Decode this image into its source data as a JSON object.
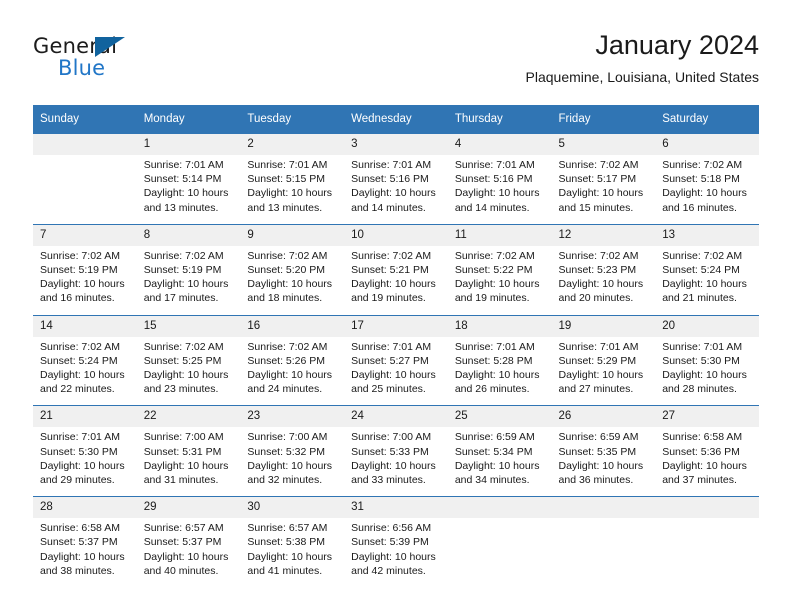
{
  "logo": {
    "text_primary": "General",
    "text_secondary": "Blue",
    "triangle_icon": "triangle-icon",
    "primary_color": "#1c1c1c",
    "secondary_color": "#2176c7",
    "triangle_color": "#11639e"
  },
  "header": {
    "title": "January 2024",
    "subtitle": "Plaquemine, Louisiana, United States"
  },
  "theme": {
    "header_bg": "#3075b4",
    "header_text": "#ffffff",
    "daynum_bg": "#f0f0f0",
    "body_text": "#1a1a1a",
    "grid_line": "#3075b4"
  },
  "weekday_headers": [
    "Sunday",
    "Monday",
    "Tuesday",
    "Wednesday",
    "Thursday",
    "Friday",
    "Saturday"
  ],
  "weeks": [
    [
      {
        "day": "",
        "lines": []
      },
      {
        "day": "1",
        "lines": [
          "Sunrise: 7:01 AM",
          "Sunset: 5:14 PM",
          "Daylight: 10 hours",
          "and 13 minutes."
        ]
      },
      {
        "day": "2",
        "lines": [
          "Sunrise: 7:01 AM",
          "Sunset: 5:15 PM",
          "Daylight: 10 hours",
          "and 13 minutes."
        ]
      },
      {
        "day": "3",
        "lines": [
          "Sunrise: 7:01 AM",
          "Sunset: 5:16 PM",
          "Daylight: 10 hours",
          "and 14 minutes."
        ]
      },
      {
        "day": "4",
        "lines": [
          "Sunrise: 7:01 AM",
          "Sunset: 5:16 PM",
          "Daylight: 10 hours",
          "and 14 minutes."
        ]
      },
      {
        "day": "5",
        "lines": [
          "Sunrise: 7:02 AM",
          "Sunset: 5:17 PM",
          "Daylight: 10 hours",
          "and 15 minutes."
        ]
      },
      {
        "day": "6",
        "lines": [
          "Sunrise: 7:02 AM",
          "Sunset: 5:18 PM",
          "Daylight: 10 hours",
          "and 16 minutes."
        ]
      }
    ],
    [
      {
        "day": "7",
        "lines": [
          "Sunrise: 7:02 AM",
          "Sunset: 5:19 PM",
          "Daylight: 10 hours",
          "and 16 minutes."
        ]
      },
      {
        "day": "8",
        "lines": [
          "Sunrise: 7:02 AM",
          "Sunset: 5:19 PM",
          "Daylight: 10 hours",
          "and 17 minutes."
        ]
      },
      {
        "day": "9",
        "lines": [
          "Sunrise: 7:02 AM",
          "Sunset: 5:20 PM",
          "Daylight: 10 hours",
          "and 18 minutes."
        ]
      },
      {
        "day": "10",
        "lines": [
          "Sunrise: 7:02 AM",
          "Sunset: 5:21 PM",
          "Daylight: 10 hours",
          "and 19 minutes."
        ]
      },
      {
        "day": "11",
        "lines": [
          "Sunrise: 7:02 AM",
          "Sunset: 5:22 PM",
          "Daylight: 10 hours",
          "and 19 minutes."
        ]
      },
      {
        "day": "12",
        "lines": [
          "Sunrise: 7:02 AM",
          "Sunset: 5:23 PM",
          "Daylight: 10 hours",
          "and 20 minutes."
        ]
      },
      {
        "day": "13",
        "lines": [
          "Sunrise: 7:02 AM",
          "Sunset: 5:24 PM",
          "Daylight: 10 hours",
          "and 21 minutes."
        ]
      }
    ],
    [
      {
        "day": "14",
        "lines": [
          "Sunrise: 7:02 AM",
          "Sunset: 5:24 PM",
          "Daylight: 10 hours",
          "and 22 minutes."
        ]
      },
      {
        "day": "15",
        "lines": [
          "Sunrise: 7:02 AM",
          "Sunset: 5:25 PM",
          "Daylight: 10 hours",
          "and 23 minutes."
        ]
      },
      {
        "day": "16",
        "lines": [
          "Sunrise: 7:02 AM",
          "Sunset: 5:26 PM",
          "Daylight: 10 hours",
          "and 24 minutes."
        ]
      },
      {
        "day": "17",
        "lines": [
          "Sunrise: 7:01 AM",
          "Sunset: 5:27 PM",
          "Daylight: 10 hours",
          "and 25 minutes."
        ]
      },
      {
        "day": "18",
        "lines": [
          "Sunrise: 7:01 AM",
          "Sunset: 5:28 PM",
          "Daylight: 10 hours",
          "and 26 minutes."
        ]
      },
      {
        "day": "19",
        "lines": [
          "Sunrise: 7:01 AM",
          "Sunset: 5:29 PM",
          "Daylight: 10 hours",
          "and 27 minutes."
        ]
      },
      {
        "day": "20",
        "lines": [
          "Sunrise: 7:01 AM",
          "Sunset: 5:30 PM",
          "Daylight: 10 hours",
          "and 28 minutes."
        ]
      }
    ],
    [
      {
        "day": "21",
        "lines": [
          "Sunrise: 7:01 AM",
          "Sunset: 5:30 PM",
          "Daylight: 10 hours",
          "and 29 minutes."
        ]
      },
      {
        "day": "22",
        "lines": [
          "Sunrise: 7:00 AM",
          "Sunset: 5:31 PM",
          "Daylight: 10 hours",
          "and 31 minutes."
        ]
      },
      {
        "day": "23",
        "lines": [
          "Sunrise: 7:00 AM",
          "Sunset: 5:32 PM",
          "Daylight: 10 hours",
          "and 32 minutes."
        ]
      },
      {
        "day": "24",
        "lines": [
          "Sunrise: 7:00 AM",
          "Sunset: 5:33 PM",
          "Daylight: 10 hours",
          "and 33 minutes."
        ]
      },
      {
        "day": "25",
        "lines": [
          "Sunrise: 6:59 AM",
          "Sunset: 5:34 PM",
          "Daylight: 10 hours",
          "and 34 minutes."
        ]
      },
      {
        "day": "26",
        "lines": [
          "Sunrise: 6:59 AM",
          "Sunset: 5:35 PM",
          "Daylight: 10 hours",
          "and 36 minutes."
        ]
      },
      {
        "day": "27",
        "lines": [
          "Sunrise: 6:58 AM",
          "Sunset: 5:36 PM",
          "Daylight: 10 hours",
          "and 37 minutes."
        ]
      }
    ],
    [
      {
        "day": "28",
        "lines": [
          "Sunrise: 6:58 AM",
          "Sunset: 5:37 PM",
          "Daylight: 10 hours",
          "and 38 minutes."
        ]
      },
      {
        "day": "29",
        "lines": [
          "Sunrise: 6:57 AM",
          "Sunset: 5:37 PM",
          "Daylight: 10 hours",
          "and 40 minutes."
        ]
      },
      {
        "day": "30",
        "lines": [
          "Sunrise: 6:57 AM",
          "Sunset: 5:38 PM",
          "Daylight: 10 hours",
          "and 41 minutes."
        ]
      },
      {
        "day": "31",
        "lines": [
          "Sunrise: 6:56 AM",
          "Sunset: 5:39 PM",
          "Daylight: 10 hours",
          "and 42 minutes."
        ]
      },
      {
        "day": "",
        "lines": []
      },
      {
        "day": "",
        "lines": []
      },
      {
        "day": "",
        "lines": []
      }
    ]
  ]
}
